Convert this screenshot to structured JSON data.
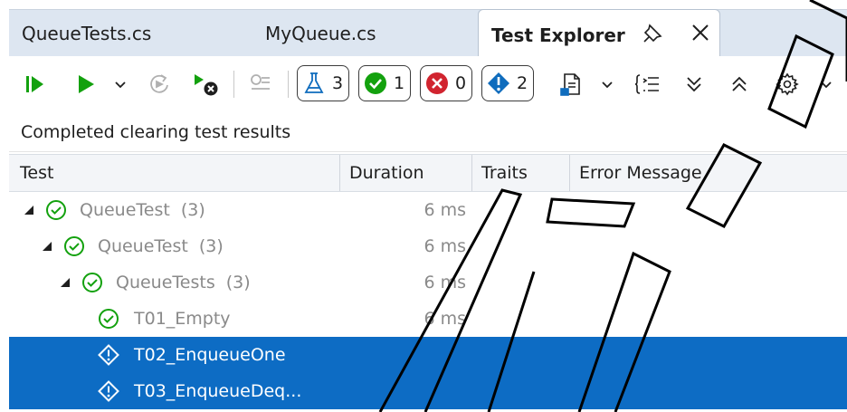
{
  "tabs": {
    "queue_tests": "QueueTests.cs",
    "my_queue": "MyQueue.cs",
    "test_explorer": "Test Explorer"
  },
  "toolbar": {
    "total_count": "3",
    "passed_count": "1",
    "failed_count": "0",
    "not_run_count": "2"
  },
  "status_text": "Completed clearing test results",
  "columns": {
    "test": "Test",
    "duration": "Duration",
    "traits": "Traits",
    "error_message": "Error Message"
  },
  "rows": [
    {
      "name": "QueueTest",
      "count": "(3)",
      "duration": "6 ms"
    },
    {
      "name": "QueueTest",
      "count": "(3)",
      "duration": "6 ms"
    },
    {
      "name": "QueueTests",
      "count": "(3)",
      "duration": "6 ms"
    },
    {
      "name": "T01_Empty",
      "duration": "6 ms"
    },
    {
      "name": "T02_EnqueueOne"
    },
    {
      "name": "T03_EnqueueDeq..."
    }
  ],
  "colors": {
    "accent_green": "#13a10e",
    "failed_red": "#d1242f",
    "info_blue": "#0f6cbd",
    "selection_blue": "#0d6cc4"
  }
}
